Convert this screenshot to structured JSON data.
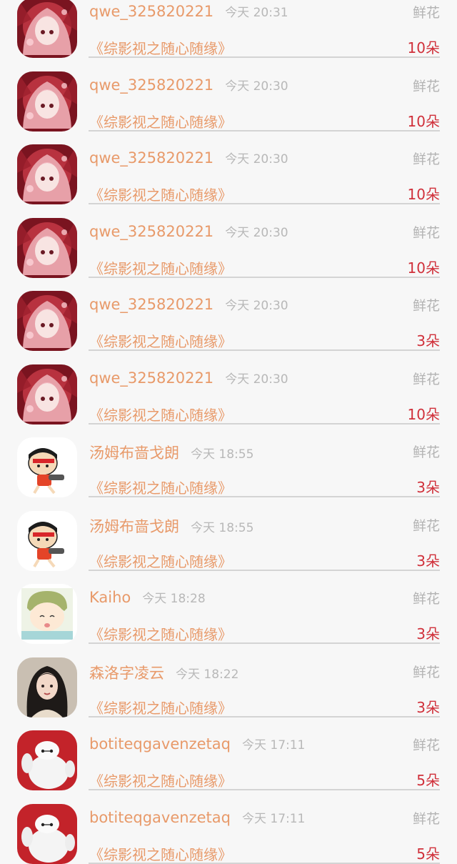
{
  "items": [
    {
      "user": "qwe_325820221",
      "time": "今天 20:31",
      "gift": "鲜花",
      "book": "《综影视之随心随缘》",
      "count": "10朵",
      "avatar": "anime-girl-icon"
    },
    {
      "user": "qwe_325820221",
      "time": "今天 20:30",
      "gift": "鲜花",
      "book": "《综影视之随心随缘》",
      "count": "10朵",
      "avatar": "anime-girl-icon"
    },
    {
      "user": "qwe_325820221",
      "time": "今天 20:30",
      "gift": "鲜花",
      "book": "《综影视之随心随缘》",
      "count": "10朵",
      "avatar": "anime-girl-icon"
    },
    {
      "user": "qwe_325820221",
      "time": "今天 20:30",
      "gift": "鲜花",
      "book": "《综影视之随心随缘》",
      "count": "10朵",
      "avatar": "anime-girl-icon"
    },
    {
      "user": "qwe_325820221",
      "time": "今天 20:30",
      "gift": "鲜花",
      "book": "《综影视之随心随缘》",
      "count": "3朵",
      "avatar": "anime-girl-icon"
    },
    {
      "user": "qwe_325820221",
      "time": "今天 20:30",
      "gift": "鲜花",
      "book": "《综影视之随心随缘》",
      "count": "10朵",
      "avatar": "anime-girl-icon"
    },
    {
      "user": "汤姆布啬戈朗",
      "time": "今天 18:55",
      "gift": "鲜花",
      "book": "《综影视之随心随缘》",
      "count": "3朵",
      "avatar": "cartoon-boy-icon"
    },
    {
      "user": "汤姆布啬戈朗",
      "time": "今天 18:55",
      "gift": "鲜花",
      "book": "《综影视之随心随缘》",
      "count": "3朵",
      "avatar": "cartoon-boy-icon"
    },
    {
      "user": "Kaiho",
      "time": "今天 18:28",
      "gift": "鲜花",
      "book": "《综影视之随心随缘》",
      "count": "3朵",
      "avatar": "baby-cartoon-icon"
    },
    {
      "user": "森洛字凌云",
      "time": "今天 18:22",
      "gift": "鲜花",
      "book": "《综影视之随心随缘》",
      "count": "3朵",
      "avatar": "woman-portrait-icon"
    },
    {
      "user": "botiteqgavenzetaq",
      "time": "今天 17:11",
      "gift": "鲜花",
      "book": "《综影视之随心随缘》",
      "count": "5朵",
      "avatar": "white-robot-icon"
    },
    {
      "user": "botiteqgavenzetaq",
      "time": "今天 17:11",
      "gift": "鲜花",
      "book": "《综影视之随心随缘》",
      "count": "5朵",
      "avatar": "white-robot-icon"
    }
  ]
}
